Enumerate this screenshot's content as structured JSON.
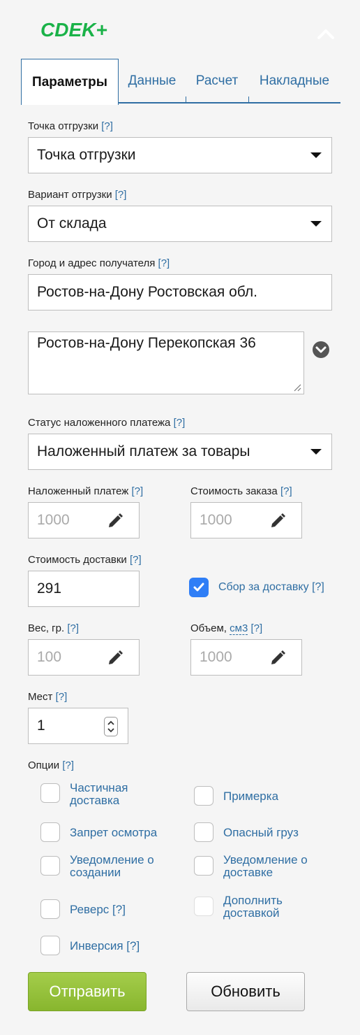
{
  "logo": {
    "text": "CDEK+",
    "color": "#1ab248"
  },
  "tabs": [
    {
      "label": "Параметры",
      "active": true
    },
    {
      "label": "Данные",
      "active": false
    },
    {
      "label": "Расчет",
      "active": false
    },
    {
      "label": "Накладные",
      "active": false
    }
  ],
  "help": "[?]",
  "shipment_point": {
    "label": "Точка отгрузки",
    "value": "Точка отгрузки"
  },
  "shipment_variant": {
    "label": "Вариант отгрузки",
    "value": "От склада"
  },
  "recipient": {
    "label": "Город и адрес получателя",
    "city": "Ростов-на-Дону Ростовская обл.",
    "address": "Ростов-на-Дону Перекопская 36"
  },
  "cod_status": {
    "label": "Статус наложенного платежа",
    "value": "Наложенный платеж за товары"
  },
  "cod": {
    "label": "Наложенный платеж",
    "placeholder": "1000"
  },
  "order_cost": {
    "label": "Стоимость заказа",
    "placeholder": "1000"
  },
  "delivery_cost": {
    "label": "Стоимость доставки",
    "value": "291"
  },
  "delivery_fee": {
    "label": "Сбор за доставку",
    "checked": true
  },
  "weight": {
    "label": "Вес, гр.",
    "placeholder": "100"
  },
  "volume": {
    "label_prefix": "Объем,",
    "unit": "см3",
    "placeholder": "1000"
  },
  "places": {
    "label": "Мест",
    "value": "1"
  },
  "options": {
    "label": "Опции",
    "items": [
      {
        "line1": "Частичная",
        "line2": "доставка"
      },
      {
        "line1": "Примерка"
      },
      {
        "line1": "Запрет осмотра"
      },
      {
        "line1": "Опасный груз"
      },
      {
        "line1": "Уведомление о",
        "line2": "создании"
      },
      {
        "line1": "Уведомление о",
        "line2": "доставке"
      },
      {
        "line1": "Реверс [?]"
      },
      {
        "line1": "Дополнить",
        "line2": "доставкой"
      },
      {
        "line1": "Инверсия [?]"
      }
    ]
  },
  "buttons": {
    "send": "Отправить",
    "refresh": "Обновить"
  },
  "colors": {
    "link": "#2f6ea3",
    "checkbox_checked": "#2f7ef6",
    "send_button": "#94c13a"
  }
}
